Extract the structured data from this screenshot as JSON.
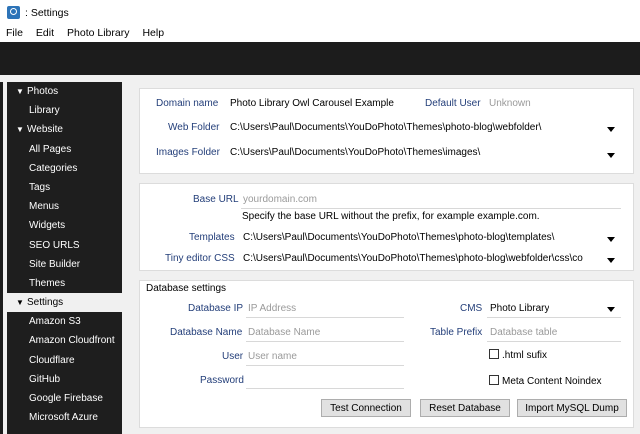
{
  "window": {
    "title": ": Settings"
  },
  "menu": [
    "File",
    "Edit",
    "Photo Library",
    "Help"
  ],
  "sidebar": {
    "items": [
      {
        "label": "Photos",
        "type": "group"
      },
      {
        "label": "Library",
        "type": "child"
      },
      {
        "label": "Website",
        "type": "group"
      },
      {
        "label": "All Pages",
        "type": "child"
      },
      {
        "label": "Categories",
        "type": "child"
      },
      {
        "label": "Tags",
        "type": "child"
      },
      {
        "label": "Menus",
        "type": "child"
      },
      {
        "label": "Widgets",
        "type": "child"
      },
      {
        "label": "SEO URLS",
        "type": "child"
      },
      {
        "label": "Site Builder",
        "type": "child"
      },
      {
        "label": "Themes",
        "type": "child"
      },
      {
        "label": "Settings",
        "type": "group-selected"
      },
      {
        "label": "Amazon S3",
        "type": "child"
      },
      {
        "label": "Amazon Cloudfront",
        "type": "child"
      },
      {
        "label": "Cloudflare",
        "type": "child"
      },
      {
        "label": "GitHub",
        "type": "child"
      },
      {
        "label": "Google Firebase",
        "type": "child"
      },
      {
        "label": "Microsoft Azure",
        "type": "child"
      }
    ]
  },
  "site": {
    "domain_label": "Domain name",
    "domain_value": "Photo Library Owl Carousel Example",
    "default_user_label": "Default User",
    "default_user_placeholder": "Unknown",
    "web_folder_label": "Web Folder",
    "web_folder_value": "C:\\Users\\Paul\\Documents\\YouDoPhoto\\Themes\\photo-blog\\webfolder\\",
    "images_folder_label": "Images Folder",
    "images_folder_value": "C:\\Users\\Paul\\Documents\\YouDoPhoto\\Themes\\images\\"
  },
  "urls": {
    "base_url_label": "Base URL",
    "base_url_placeholder": "yourdomain.com",
    "base_url_help": "Specify the base URL without the prefix, for example example.com.",
    "templates_label": "Templates",
    "templates_value": "C:\\Users\\Paul\\Documents\\YouDoPhoto\\Themes\\photo-blog\\templates\\",
    "tiny_editor_label": "Tiny editor CSS",
    "tiny_editor_value": "C:\\Users\\Paul\\Documents\\YouDoPhoto\\Themes\\photo-blog\\webfolder\\css\\co"
  },
  "database": {
    "section_title": "Database settings",
    "ip_label": "Database IP",
    "ip_placeholder": "IP Address",
    "name_label": "Database Name",
    "name_placeholder": "Database Name",
    "user_label": "User",
    "user_placeholder": "User name",
    "password_label": "Password",
    "cms_label": "CMS",
    "cms_value": "Photo Library",
    "prefix_label": "Table Prefix",
    "prefix_placeholder": "Database table",
    "html_suffix_label": ".html sufix",
    "noindex_label": "Meta Content Noindex",
    "test_button": "Test Connection",
    "reset_button": "Reset Database",
    "import_button": "Import MySQL Dump"
  }
}
